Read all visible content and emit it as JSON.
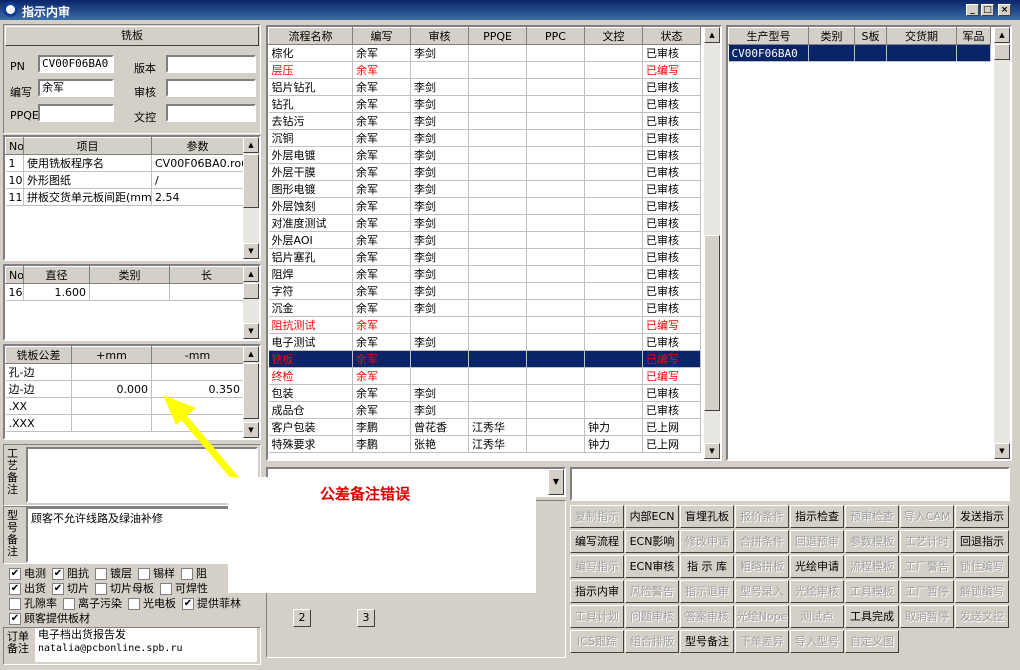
{
  "window": {
    "title": "指示内审"
  },
  "left": {
    "section_title": "铣板",
    "pn_label": "PN",
    "pn_value": "CV00F06BA0",
    "version_label": "版本",
    "version_value": "",
    "author_label": "编写",
    "author_value": "余军",
    "review_label": "审核",
    "review_value": "",
    "ppqe_label": "PPQE",
    "ppqe_value": "",
    "doc_label": "文控",
    "doc_value": "",
    "params": {
      "headers": [
        "No",
        "项目",
        "参数"
      ],
      "rows": [
        [
          "1",
          "使用铣板程序名",
          "CV00F06BA0.rou"
        ],
        [
          "10",
          "外形图纸",
          "/"
        ],
        [
          "11",
          "拼板交货单元板间距(mm",
          "2.54"
        ]
      ]
    },
    "drills": {
      "headers": [
        "No",
        "直径",
        "类别",
        "长"
      ],
      "rows": [
        [
          "16",
          "1.600",
          "",
          ""
        ]
      ]
    },
    "tolerance": {
      "headers": [
        "铣板公差",
        "+mm",
        "-mm"
      ],
      "rows": [
        [
          "孔-边",
          "",
          ""
        ],
        [
          "边-边",
          "0.000",
          "0.350"
        ],
        [
          ".XX",
          "",
          ""
        ],
        [
          ".XXX",
          "",
          ""
        ]
      ]
    },
    "process_note_label": "工艺备注",
    "process_note_value": "",
    "model_note_label": "型号备注",
    "model_note_value": "顾客不允许线路及绿油补修",
    "checkboxes_row1": [
      {
        "label": "电测",
        "checked": true
      },
      {
        "label": "阻抗",
        "checked": true
      },
      {
        "label": "镀层",
        "checked": false
      },
      {
        "label": "锡样",
        "checked": false
      },
      {
        "label": "阻",
        "checked": false
      }
    ],
    "checkboxes_row2": [
      {
        "label": "出货",
        "checked": true
      },
      {
        "label": "切片",
        "checked": true
      },
      {
        "label": "切片母板",
        "checked": false
      },
      {
        "label": "可焊性",
        "checked": false
      }
    ],
    "checkboxes_row3": [
      {
        "label": "孔隙率",
        "checked": false
      },
      {
        "label": "离子污染",
        "checked": false
      },
      {
        "label": "光电板",
        "checked": false
      },
      {
        "label": "提供菲林",
        "checked": true
      }
    ],
    "checkboxes_row4": [
      {
        "label": "顾客提供板材",
        "checked": true
      }
    ],
    "order_note_label": "订单备注",
    "order_note_line1": "电子档出货报告发",
    "order_note_line2": "natalia@pcbonline.spb.ru"
  },
  "flow": {
    "headers": [
      "流程名称",
      "编写",
      "审核",
      "PPQE",
      "PPC",
      "文控",
      "状态"
    ],
    "rows": [
      {
        "cells": [
          "棕化",
          "余军",
          "李剑",
          "",
          "",
          "",
          "已审核"
        ],
        "red": false,
        "selected": false
      },
      {
        "cells": [
          "层压",
          "余军",
          "",
          "",
          "",
          "",
          "已编写"
        ],
        "red": true,
        "selected": false
      },
      {
        "cells": [
          "铝片钻孔",
          "余军",
          "李剑",
          "",
          "",
          "",
          "已审核"
        ],
        "red": false,
        "selected": false
      },
      {
        "cells": [
          "钻孔",
          "余军",
          "李剑",
          "",
          "",
          "",
          "已审核"
        ],
        "red": false,
        "selected": false
      },
      {
        "cells": [
          "去钻污",
          "余军",
          "李剑",
          "",
          "",
          "",
          "已审核"
        ],
        "red": false,
        "selected": false
      },
      {
        "cells": [
          "沉铜",
          "余军",
          "李剑",
          "",
          "",
          "",
          "已审核"
        ],
        "red": false,
        "selected": false
      },
      {
        "cells": [
          "外层电镀",
          "余军",
          "李剑",
          "",
          "",
          "",
          "已审核"
        ],
        "red": false,
        "selected": false
      },
      {
        "cells": [
          "外层干膜",
          "余军",
          "李剑",
          "",
          "",
          "",
          "已审核"
        ],
        "red": false,
        "selected": false
      },
      {
        "cells": [
          "图形电镀",
          "余军",
          "李剑",
          "",
          "",
          "",
          "已审核"
        ],
        "red": false,
        "selected": false
      },
      {
        "cells": [
          "外层蚀刻",
          "余军",
          "李剑",
          "",
          "",
          "",
          "已审核"
        ],
        "red": false,
        "selected": false
      },
      {
        "cells": [
          "对准度测试",
          "余军",
          "李剑",
          "",
          "",
          "",
          "已审核"
        ],
        "red": false,
        "selected": false
      },
      {
        "cells": [
          "外层AOI",
          "余军",
          "李剑",
          "",
          "",
          "",
          "已审核"
        ],
        "red": false,
        "selected": false
      },
      {
        "cells": [
          "铝片塞孔",
          "余军",
          "李剑",
          "",
          "",
          "",
          "已审核"
        ],
        "red": false,
        "selected": false
      },
      {
        "cells": [
          "阻焊",
          "余军",
          "李剑",
          "",
          "",
          "",
          "已审核"
        ],
        "red": false,
        "selected": false
      },
      {
        "cells": [
          "字符",
          "余军",
          "李剑",
          "",
          "",
          "",
          "已审核"
        ],
        "red": false,
        "selected": false
      },
      {
        "cells": [
          "沉金",
          "余军",
          "李剑",
          "",
          "",
          "",
          "已审核"
        ],
        "red": false,
        "selected": false
      },
      {
        "cells": [
          "阻抗测试",
          "余军",
          "",
          "",
          "",
          "",
          "已编写"
        ],
        "red": true,
        "selected": false
      },
      {
        "cells": [
          "电子测试",
          "余军",
          "李剑",
          "",
          "",
          "",
          "已审核"
        ],
        "red": false,
        "selected": false
      },
      {
        "cells": [
          "铣板",
          "余军",
          "",
          "",
          "",
          "",
          "已编写"
        ],
        "red": true,
        "selected": true
      },
      {
        "cells": [
          "终检",
          "余军",
          "",
          "",
          "",
          "",
          "已编写"
        ],
        "red": true,
        "selected": false
      },
      {
        "cells": [
          "包装",
          "余军",
          "李剑",
          "",
          "",
          "",
          "已审核"
        ],
        "red": false,
        "selected": false
      },
      {
        "cells": [
          "成品仓",
          "余军",
          "李剑",
          "",
          "",
          "",
          "已审核"
        ],
        "red": false,
        "selected": false
      },
      {
        "cells": [
          "客户包装",
          "李鹏",
          "曾花香",
          "江秀华",
          "",
          "钟力",
          "已上网"
        ],
        "red": false,
        "selected": false
      },
      {
        "cells": [
          "特殊要求",
          "李鹏",
          "张艳",
          "江秀华",
          "",
          "钟力",
          "已上网"
        ],
        "red": false,
        "selected": false
      }
    ]
  },
  "models": {
    "headers": [
      "生产型号",
      "类别",
      "S板",
      "交货期",
      "军品"
    ],
    "rows": [
      [
        "CV00F06BA0",
        "",
        "",
        "",
        ""
      ]
    ]
  },
  "annotation": {
    "text": "公差备注错误",
    "color": "#e00000",
    "arrow_color": "#ffff00"
  },
  "page_buttons": [
    "2",
    "3"
  ],
  "buttons": [
    [
      {
        "t": "复制指示",
        "e": false
      },
      {
        "t": "内部ECN",
        "e": true
      },
      {
        "t": "盲埋孔板",
        "e": true
      },
      {
        "t": "报价条件",
        "e": false
      },
      {
        "t": "指示检查",
        "e": true
      },
      {
        "t": "预审检查",
        "e": false
      },
      {
        "t": "导入CAM",
        "e": false
      },
      {
        "t": "发送指示",
        "e": true
      }
    ],
    [
      {
        "t": "编写流程",
        "e": true
      },
      {
        "t": "ECN影响",
        "e": true
      },
      {
        "t": "修改申请",
        "e": false
      },
      {
        "t": "合拼条件",
        "e": false
      },
      {
        "t": "回退预审",
        "e": false
      },
      {
        "t": "参数模板",
        "e": false
      },
      {
        "t": "工艺计时",
        "e": false
      },
      {
        "t": "回退指示",
        "e": true
      }
    ],
    [
      {
        "t": "编写指示",
        "e": false
      },
      {
        "t": "ECN审核",
        "e": true
      },
      {
        "t": "指 示 库",
        "e": true
      },
      {
        "t": "粗略拼板",
        "e": false
      },
      {
        "t": "光绘申请",
        "e": true
      },
      {
        "t": "流程模板",
        "e": false
      },
      {
        "t": "工厂警告",
        "e": false
      },
      {
        "t": "锁住编写",
        "e": false
      }
    ],
    [
      {
        "t": "指示内审",
        "e": true
      },
      {
        "t": "风险警告",
        "e": false
      },
      {
        "t": "指示退审",
        "e": false
      },
      {
        "t": "型号录入",
        "e": false
      },
      {
        "t": "光绘审核",
        "e": false
      },
      {
        "t": "工具模板",
        "e": false
      },
      {
        "t": "工厂暂停",
        "e": false
      },
      {
        "t": "解锁编写",
        "e": false
      }
    ],
    [
      {
        "t": "工具计划",
        "e": false
      },
      {
        "t": "问题审核",
        "e": false
      },
      {
        "t": "答案审核",
        "e": false
      },
      {
        "t": "光绘Nope",
        "e": false
      },
      {
        "t": "测试点",
        "e": false
      },
      {
        "t": "工具完成",
        "e": true
      },
      {
        "t": "取消暂停",
        "e": false
      },
      {
        "t": "发送文控",
        "e": false
      }
    ],
    [
      {
        "t": "ICS跟踪",
        "e": false
      },
      {
        "t": "组合排版",
        "e": false
      },
      {
        "t": "型号备注",
        "e": true
      },
      {
        "t": "下单差异",
        "e": false
      },
      {
        "t": "导入型号",
        "e": false
      },
      {
        "t": "自定义图",
        "e": false
      }
    ]
  ]
}
